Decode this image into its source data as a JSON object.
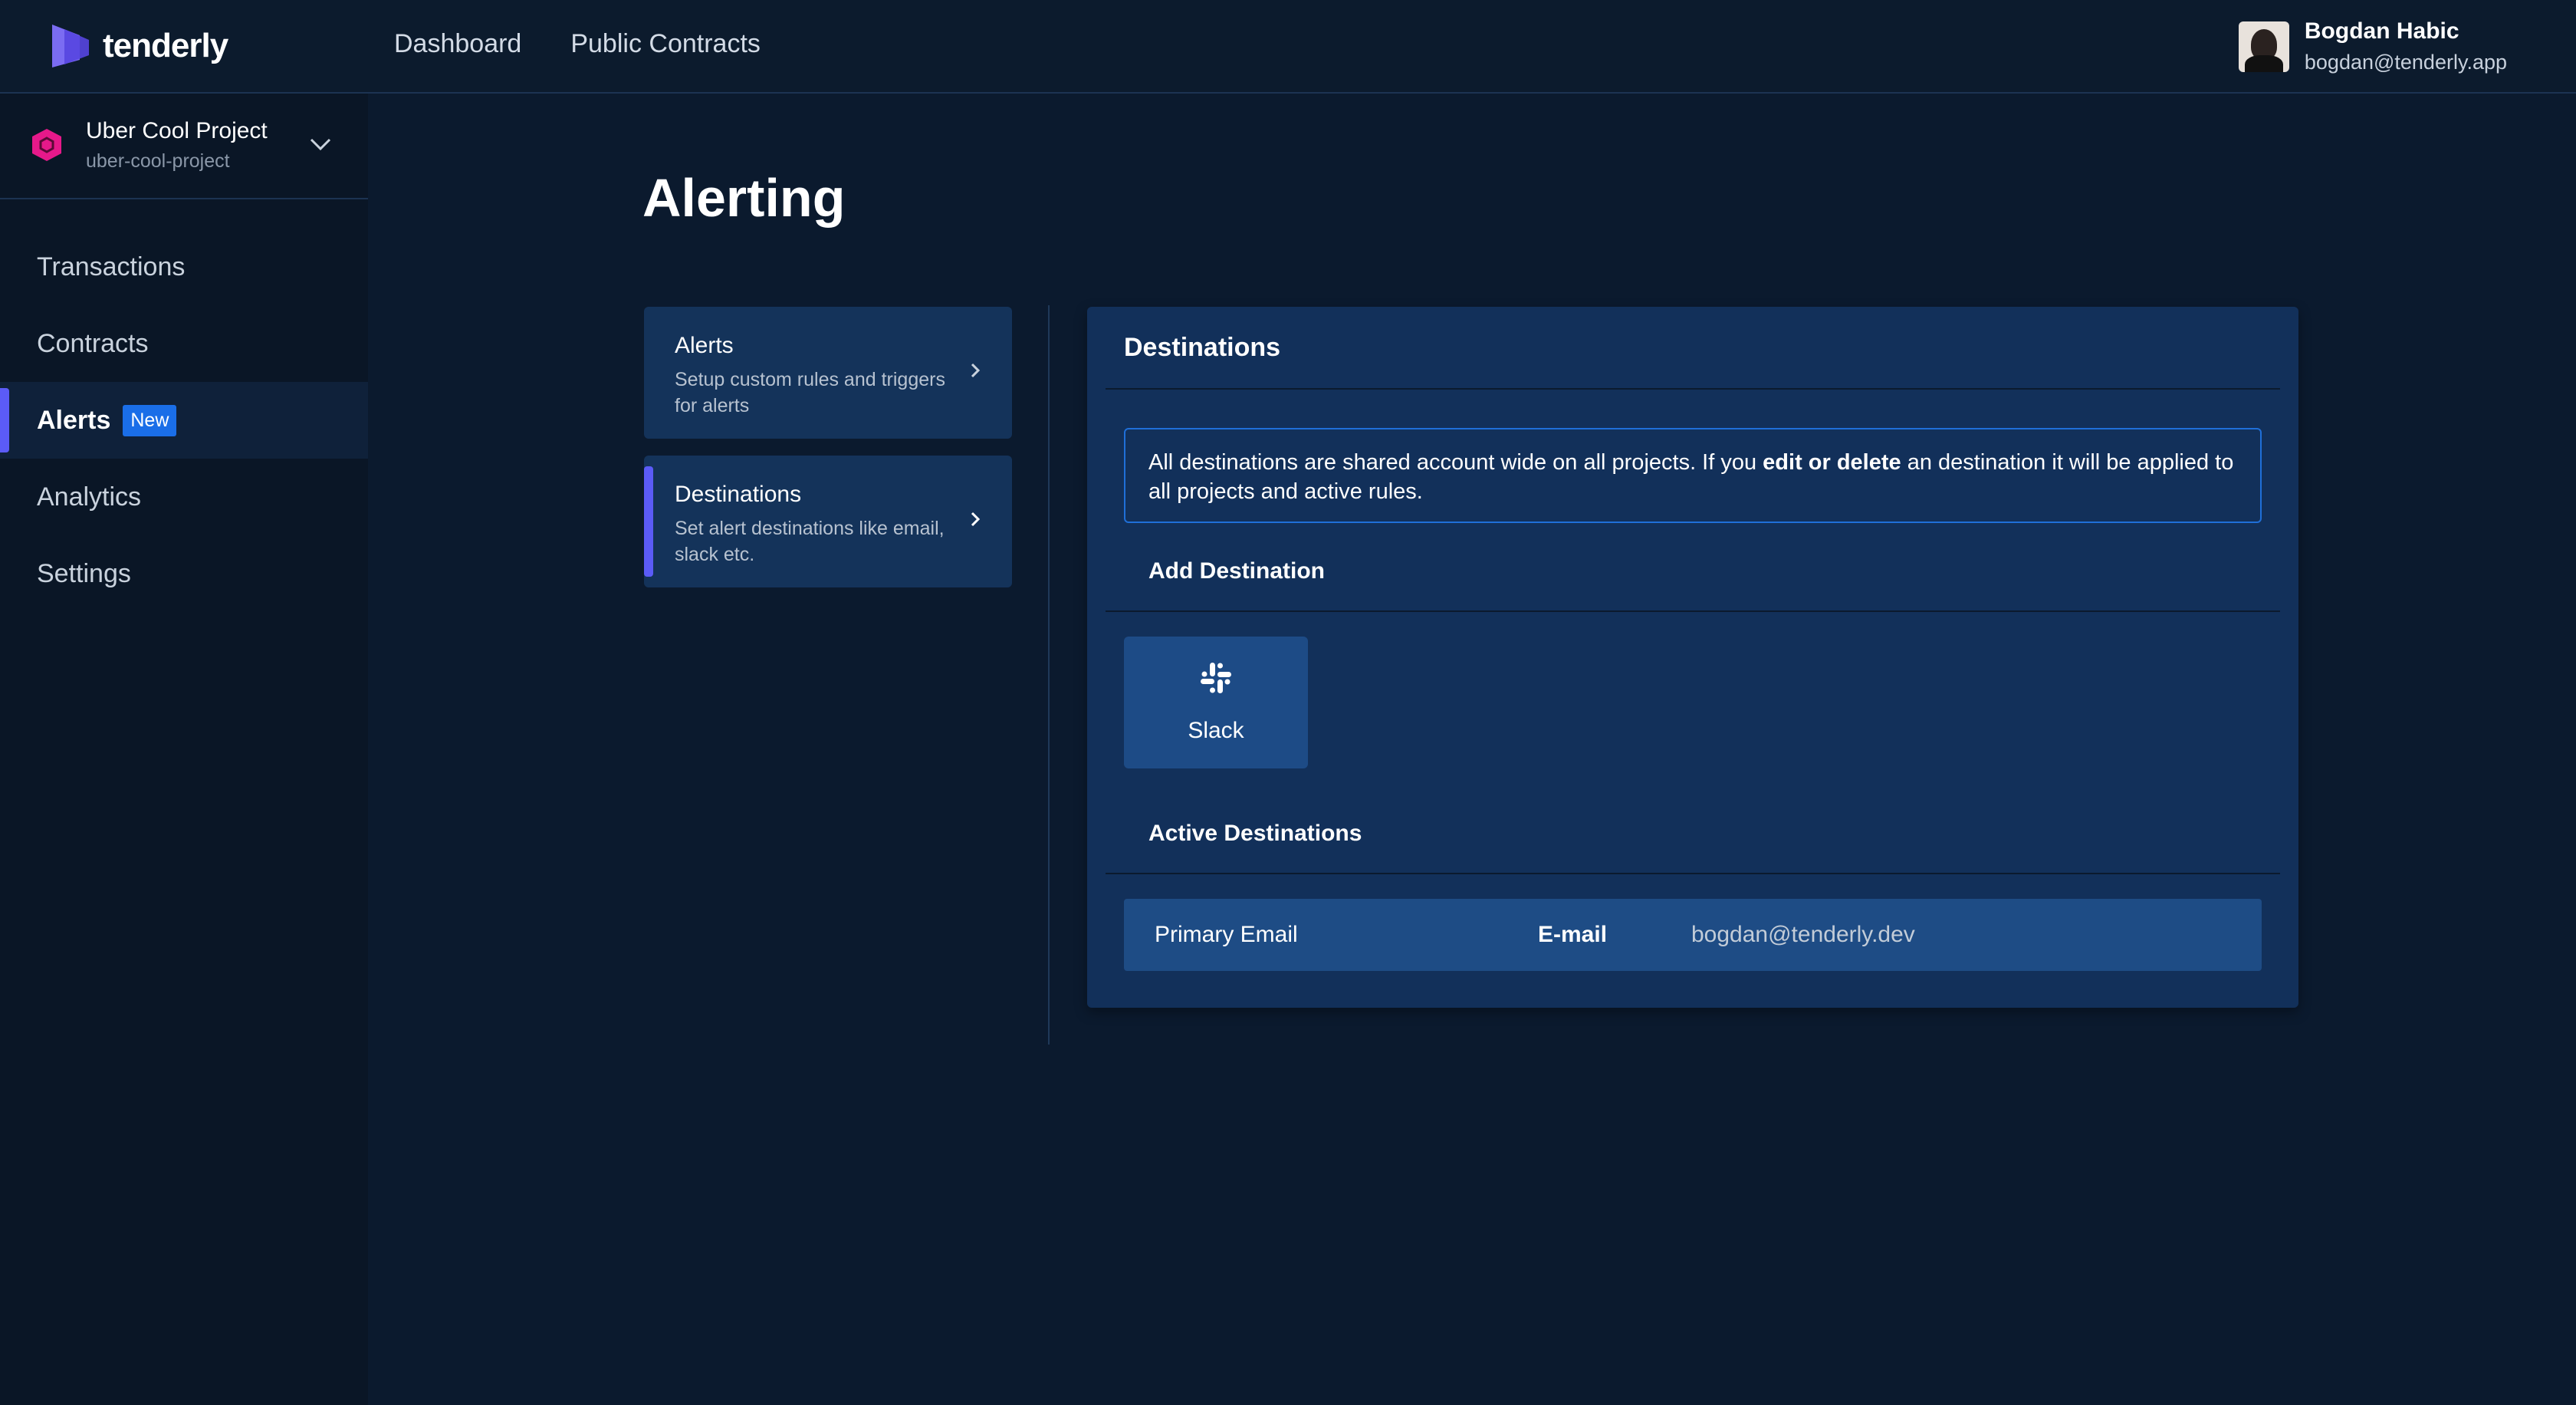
{
  "app": {
    "logo_text": "tenderly"
  },
  "topnav": {
    "dashboard": "Dashboard",
    "public_contracts": "Public Contracts"
  },
  "user": {
    "name": "Bogdan Habic",
    "email": "bogdan@tenderly.app"
  },
  "project": {
    "name": "Uber Cool Project",
    "slug": "uber-cool-project"
  },
  "sidebar": {
    "items": [
      {
        "label": "Transactions"
      },
      {
        "label": "Contracts"
      },
      {
        "label": "Alerts",
        "badge": "New",
        "active": true
      },
      {
        "label": "Analytics"
      },
      {
        "label": "Settings"
      }
    ]
  },
  "page": {
    "title": "Alerting"
  },
  "menu": [
    {
      "title": "Alerts",
      "description": "Setup custom rules and triggers for alerts"
    },
    {
      "title": "Destinations",
      "description": "Set alert destinations like email, slack etc.",
      "active": true
    }
  ],
  "panel": {
    "title": "Destinations",
    "info": {
      "before": "All destinations are shared account wide on all projects. If you ",
      "bold": "edit or delete",
      "after": " an destination it will be applied to all projects and active rules."
    },
    "add_destination_label": "Add Destination",
    "destination_types": [
      {
        "label": "Slack",
        "icon": "slack-icon"
      }
    ],
    "active_destinations_label": "Active Destinations",
    "active_destinations": [
      {
        "name": "Primary Email",
        "type": "E-mail",
        "value": "bogdan@tenderly.dev"
      }
    ]
  },
  "colors": {
    "background": "#0b1a2e",
    "accent": "#5b5bf7",
    "badge": "#1a6ee8",
    "project_icon": "#e6198a"
  }
}
